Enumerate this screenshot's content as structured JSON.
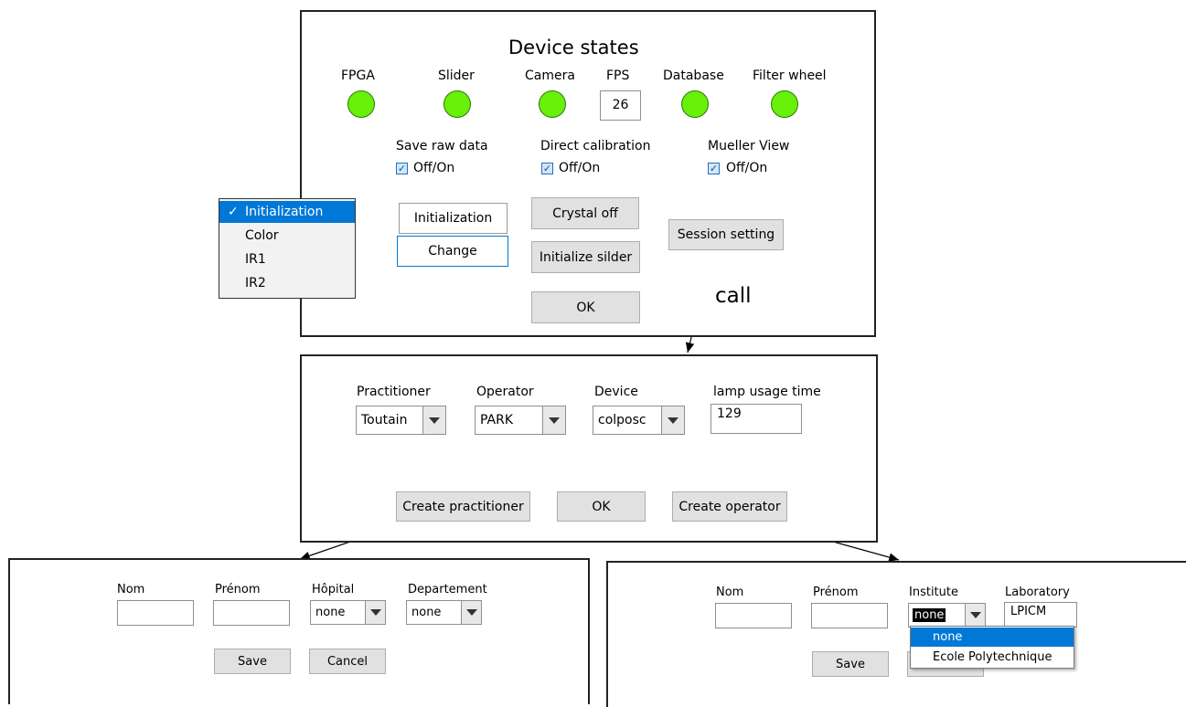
{
  "device_states": {
    "title": "Device states",
    "indicators": [
      {
        "label": "FPGA",
        "status_color": "#69f00a"
      },
      {
        "label": "Slider",
        "status_color": "#69f00a"
      },
      {
        "label": "Camera",
        "status_color": "#69f00a"
      },
      {
        "label": "Database",
        "status_color": "#69f00a"
      },
      {
        "label": "Filter wheel",
        "status_color": "#69f00a"
      }
    ],
    "fps_label": "FPS",
    "fps_value": "26",
    "checks": [
      {
        "title": "Save raw data",
        "label": "Off/On",
        "checked": true
      },
      {
        "title": "Direct calibration",
        "label": "Off/On",
        "checked": true
      },
      {
        "title": "Mueller View",
        "label": "Off/On",
        "checked": true
      }
    ],
    "mode_button": "Initialization",
    "change_button": "Change",
    "crystal_button": "Crystal off",
    "init_slider_button": "Initialize silder",
    "session_button": "Session setting",
    "ok_button": "OK",
    "mode_menu": {
      "checkmark": "✓",
      "items": [
        "Initialization",
        "Color",
        "IR1",
        "IR2"
      ],
      "selected": "Initialization"
    }
  },
  "call_annotation": "call",
  "session": {
    "practitioner_label": "Practitioner",
    "practitioner_value": "Toutain",
    "operator_label": "Operator",
    "operator_value": "PARK",
    "device_label": "Device",
    "device_value": "colposc",
    "lamp_label": "lamp usage time",
    "lamp_value": "129",
    "create_practitioner_button": "Create practitioner",
    "ok_button": "OK",
    "create_operator_button": "Create operator"
  },
  "practitioner_form": {
    "nom_label": "Nom",
    "prenom_label": "Prénom",
    "hopital_label": "Hôpital",
    "hopital_value": "none",
    "departement_label": "Departement",
    "departement_value": "none",
    "save_button": "Save",
    "cancel_button": "Cancel"
  },
  "operator_form": {
    "nom_label": "Nom",
    "prenom_label": "Prénom",
    "institute_label": "Institute",
    "institute_value": "none",
    "laboratory_label": "Laboratory",
    "laboratory_value": "LPICM",
    "institute_options": [
      "none",
      "Ecole Polytechnique"
    ],
    "save_button": "Save"
  },
  "colors": {
    "led_green": "#69f00a",
    "selection_blue": "#0078d7"
  }
}
